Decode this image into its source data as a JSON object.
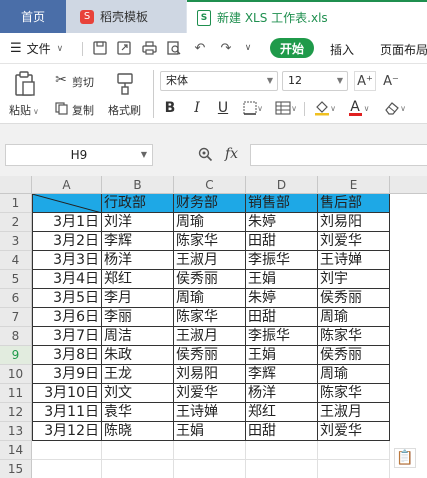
{
  "tabs": {
    "home": "首页",
    "daoke": "稻壳模板",
    "file": "新建 XLS 工作表.xls"
  },
  "menu": {
    "file": "文件",
    "start": "开始",
    "insert": "插入",
    "layout": "页面布局"
  },
  "ribbon": {
    "paste": "粘贴",
    "cut": "剪切",
    "copy": "复制",
    "format_painter": "格式刷",
    "font_name": "宋体",
    "font_size": "12",
    "bold": "B",
    "italic": "I",
    "underline": "U",
    "font_color_glyph": "A",
    "grow_font": "A⁺",
    "shrink_font": "A⁻"
  },
  "formula_bar": {
    "cell_ref": "H9",
    "fx": "fx",
    "formula": ""
  },
  "sheet": {
    "columns": [
      "A",
      "B",
      "C",
      "D",
      "E"
    ],
    "rows": [
      "1",
      "2",
      "3",
      "4",
      "5",
      "6",
      "7",
      "8",
      "9",
      "10",
      "11",
      "12",
      "13",
      "14",
      "15"
    ],
    "selected_row": "9",
    "header_cells": [
      "",
      "行政部",
      "财务部",
      "销售部",
      "售后部"
    ],
    "data": [
      [
        "3月1日",
        "刘洋",
        "周瑜",
        "朱婷",
        "刘易阳"
      ],
      [
        "3月2日",
        "李辉",
        "陈家华",
        "田甜",
        "刘爱华"
      ],
      [
        "3月3日",
        "杨洋",
        "王淑月",
        "李振华",
        "王诗婵"
      ],
      [
        "3月4日",
        "郑红",
        "侯秀丽",
        "王娟",
        "刘宇"
      ],
      [
        "3月5日",
        "李月",
        "周瑜",
        "朱婷",
        "侯秀丽"
      ],
      [
        "3月6日",
        "李丽",
        "陈家华",
        "田甜",
        "周瑜"
      ],
      [
        "3月7日",
        "周洁",
        "王淑月",
        "李振华",
        "陈家华"
      ],
      [
        "3月8日",
        "朱政",
        "侯秀丽",
        "王娟",
        "侯秀丽"
      ],
      [
        "3月9日",
        "王龙",
        "刘易阳",
        "李辉",
        "周瑜"
      ],
      [
        "3月10日",
        "刘文",
        "刘爱华",
        "杨洋",
        "陈家华"
      ],
      [
        "3月11日",
        "袁华",
        "王诗婵",
        "郑红",
        "王淑月"
      ],
      [
        "3月12日",
        "陈晓",
        "王娟",
        "田甜",
        "刘爱华"
      ]
    ]
  },
  "colors": {
    "accent_green": "#1f9a4a",
    "header_fill": "#1ea8e6",
    "home_tab": "#4a6ea8"
  }
}
